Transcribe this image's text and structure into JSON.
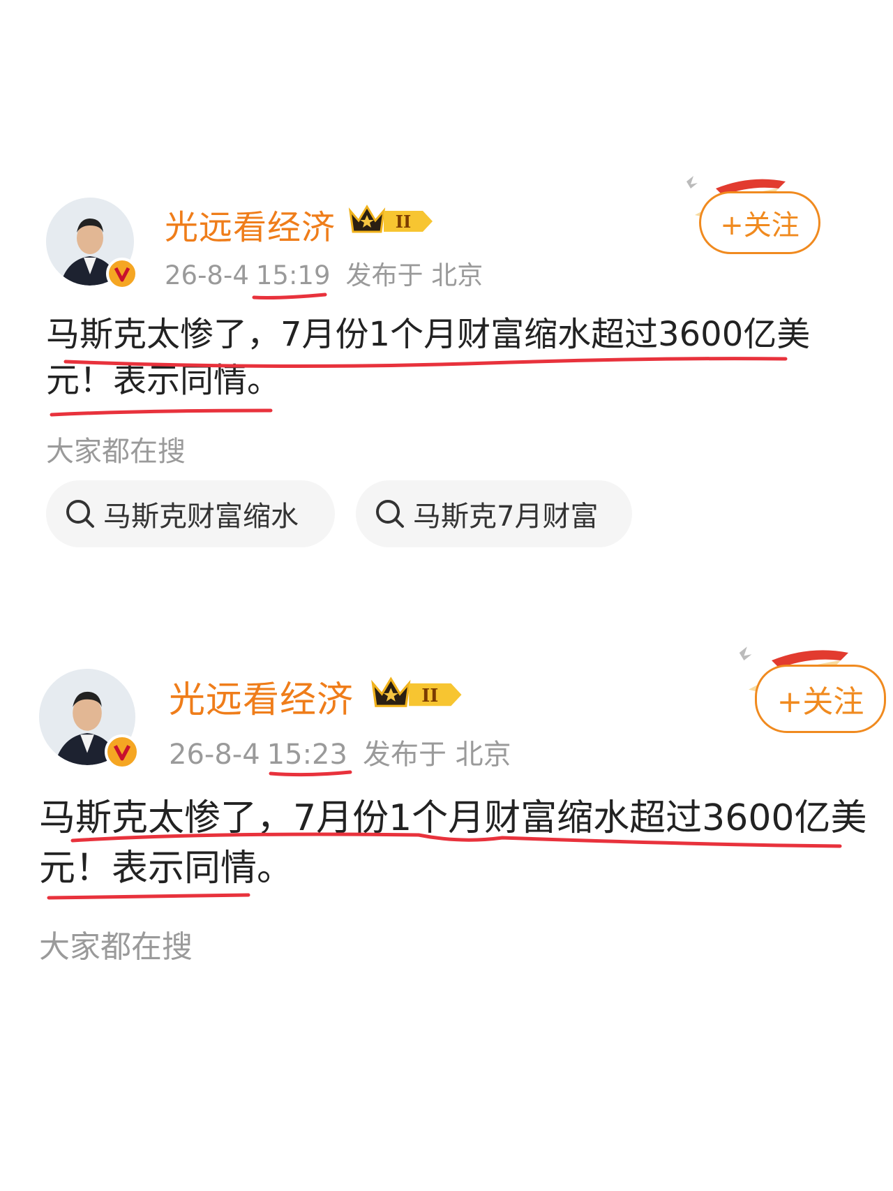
{
  "posts": [
    {
      "username": "光远看经济",
      "level_badge": "II",
      "time_date": "26-8-4",
      "time_clock": "15:19",
      "location": "发布于 北京",
      "follow_label": "+关注",
      "content_line1": "马斯克太惨了，7月份1个月财富缩水超过3600亿美",
      "content_line2": "元！表示同情。",
      "hot_label": "大家都在搜",
      "chips": [
        "马斯克财富缩水",
        "马斯克7月财富"
      ]
    },
    {
      "username": "光远看经济",
      "level_badge": "II",
      "time_date": "26-8-4",
      "time_clock": "15:23",
      "location": "发布于 北京",
      "follow_label": "+关注",
      "content_line1": "马斯克太惨了，7月份1个月财富缩水超过3600亿美",
      "content_line2": "元！表示同情。",
      "hot_label": "大家都在搜"
    }
  ],
  "colors": {
    "accent": "#ef7d1a",
    "annotation_red": "#e8323c",
    "meta_gray": "#9a9a9a"
  }
}
